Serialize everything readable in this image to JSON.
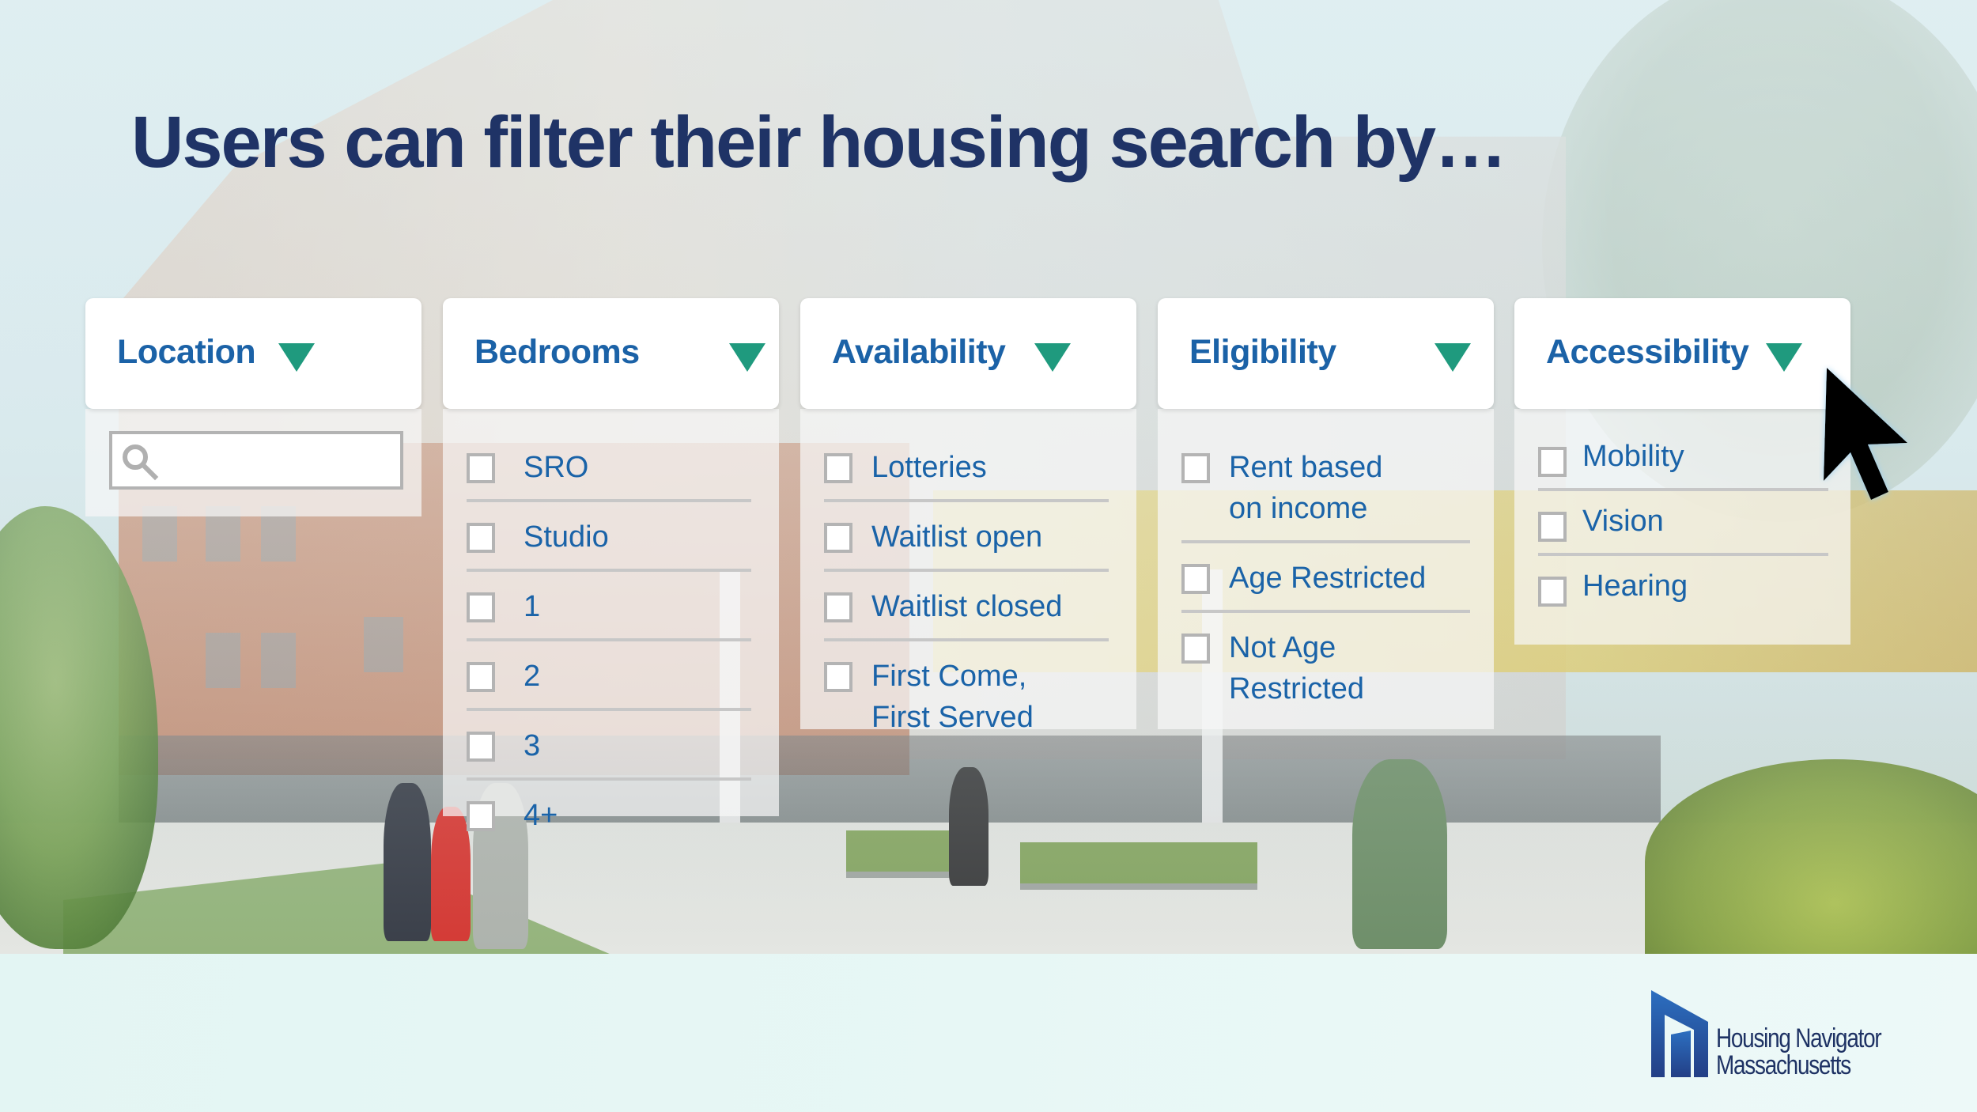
{
  "headline": "Users can filter their housing search by…",
  "colors": {
    "title_navy": "#1f3366",
    "label_blue": "#1b62a7",
    "caret_teal": "#1f9a7e",
    "checkbox_border": "#b4b4b4",
    "footer_bg": "#e6f6f4"
  },
  "filters": [
    {
      "id": "location",
      "title": "Location",
      "icon": "caret-down-icon",
      "search": {
        "icon": "search-icon",
        "value": "",
        "placeholder": ""
      }
    },
    {
      "id": "bedrooms",
      "title": "Bedrooms",
      "icon": "caret-down-icon",
      "options": [
        {
          "label": "SRO",
          "checked": false
        },
        {
          "label": "Studio",
          "checked": false
        },
        {
          "label": "1",
          "checked": false
        },
        {
          "label": "2",
          "checked": false
        },
        {
          "label": "3",
          "checked": false
        },
        {
          "label": "4+",
          "checked": false
        }
      ]
    },
    {
      "id": "availability",
      "title": "Availability",
      "icon": "caret-down-icon",
      "options": [
        {
          "label": "Lotteries",
          "checked": false
        },
        {
          "label": "Waitlist open",
          "checked": false
        },
        {
          "label": "Waitlist closed",
          "checked": false
        },
        {
          "label": "First Come,\nFirst Served",
          "checked": false
        }
      ]
    },
    {
      "id": "eligibility",
      "title": "Eligibility",
      "icon": "caret-down-icon",
      "options": [
        {
          "label": "Rent based\non income",
          "checked": false
        },
        {
          "label": "Age Restricted",
          "checked": false
        },
        {
          "label": "Not Age\nRestricted",
          "checked": false
        }
      ]
    },
    {
      "id": "accessibility",
      "title": "Accessibility",
      "icon": "caret-down-icon",
      "options": [
        {
          "label": "Mobility",
          "checked": false
        },
        {
          "label": "Vision",
          "checked": false
        },
        {
          "label": "Hearing",
          "checked": false
        }
      ]
    }
  ],
  "cursor": {
    "icon": "mouse-pointer-icon"
  },
  "logo": {
    "icon": "housing-navigator-logo-icon",
    "line1": "Housing Navigator",
    "line2": "Massachusetts"
  }
}
